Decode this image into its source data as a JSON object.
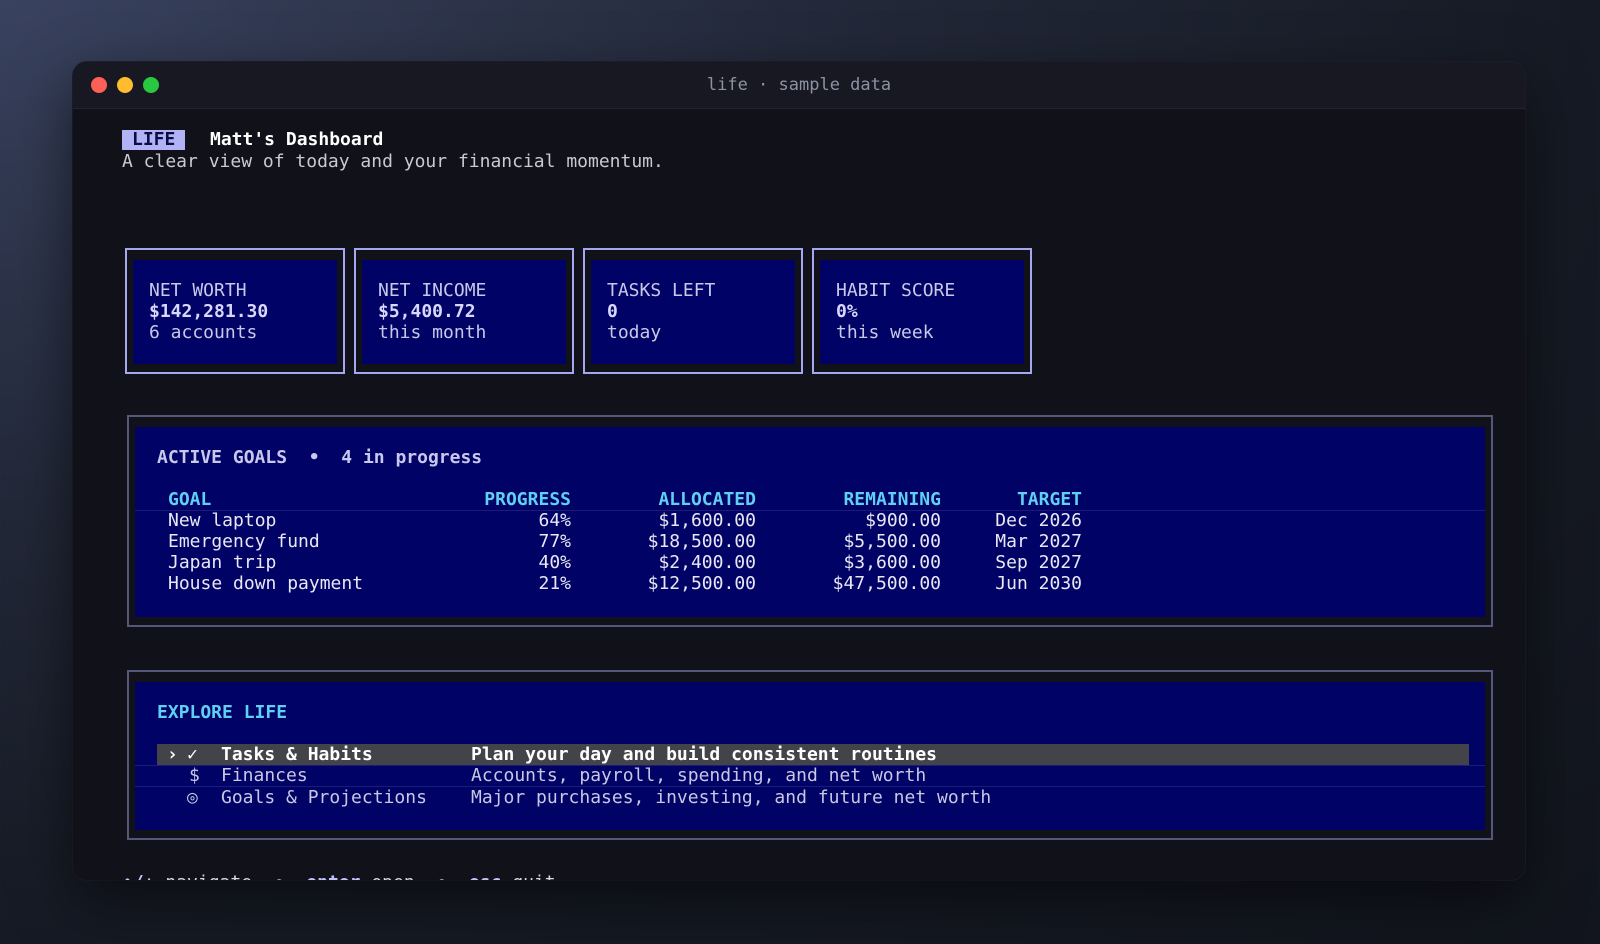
{
  "window": {
    "title": "life · sample data"
  },
  "header": {
    "badge": "LIFE",
    "title": "Matt's Dashboard",
    "subtitle": "A clear view of today and your financial momentum."
  },
  "cards": [
    {
      "label": "NET WORTH",
      "value": "$142,281.30",
      "sub": "6 accounts"
    },
    {
      "label": "NET INCOME",
      "value": "$5,400.72",
      "sub": "this month"
    },
    {
      "label": "TASKS LEFT",
      "value": "0",
      "sub": "today"
    },
    {
      "label": "HABIT SCORE",
      "value": "0%",
      "sub": "this week"
    }
  ],
  "goals": {
    "title": "ACTIVE GOALS",
    "separator": "•",
    "count": "4 in progress",
    "columns": [
      "GOAL",
      "PROGRESS",
      "ALLOCATED",
      "REMAINING",
      "TARGET"
    ],
    "rows": [
      {
        "goal": "New laptop",
        "progress": "64%",
        "allocated": "$1,600.00",
        "remaining": "$900.00",
        "target": "Dec 2026"
      },
      {
        "goal": "Emergency fund",
        "progress": "77%",
        "allocated": "$18,500.00",
        "remaining": "$5,500.00",
        "target": "Mar 2027"
      },
      {
        "goal": "Japan trip",
        "progress": "40%",
        "allocated": "$2,400.00",
        "remaining": "$3,600.00",
        "target": "Sep 2027"
      },
      {
        "goal": "House down payment",
        "progress": "21%",
        "allocated": "$12,500.00",
        "remaining": "$47,500.00",
        "target": "Jun 2030"
      }
    ]
  },
  "explore": {
    "title": "EXPLORE LIFE",
    "items": [
      {
        "cursor": "›",
        "icon": "✓",
        "label": "Tasks & Habits",
        "desc": "Plan your day and build consistent routines"
      },
      {
        "cursor": "",
        "icon": "$",
        "label": "Finances",
        "desc": "Accounts, payroll, spending, and net worth"
      },
      {
        "cursor": "",
        "icon": "◎",
        "label": "Goals & Projections",
        "desc": "Major purchases, investing, and future net worth"
      }
    ]
  },
  "footer": {
    "nav_key": "↑/↓",
    "nav_label": "navigate",
    "open_key": "enter",
    "open_label": "open",
    "quit_key": "esc",
    "quit_label": "quit",
    "bullet": "•"
  }
}
